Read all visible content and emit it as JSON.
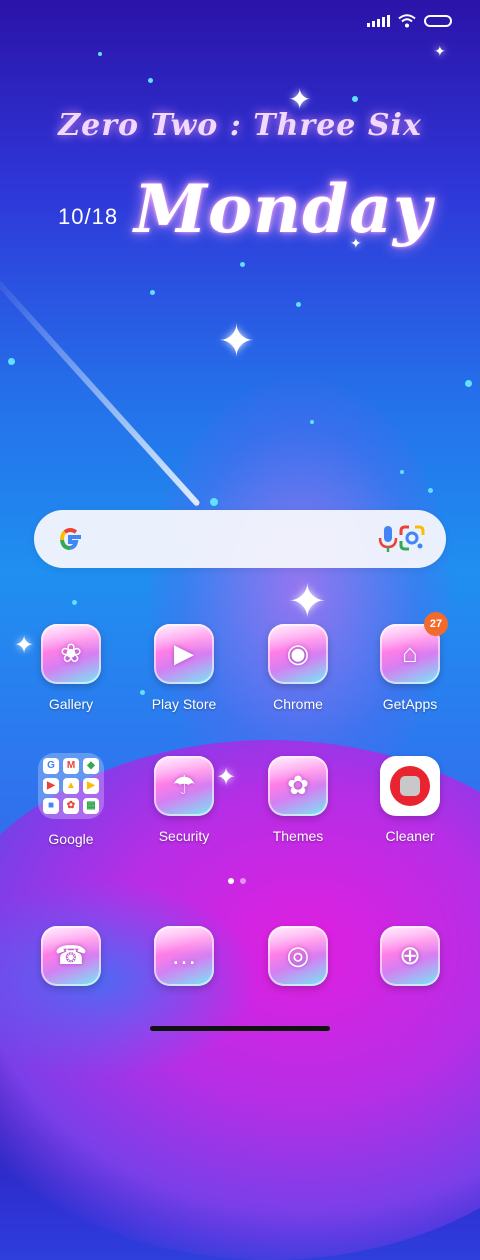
{
  "status_bar": {
    "signal_icon": "signal-icon",
    "wifi_icon": "wifi-icon",
    "battery_icon": "battery-icon"
  },
  "clock_widget": {
    "time_text": "Zero Two : Three Six",
    "date": "10/18",
    "day": "Monday"
  },
  "search_bar": {
    "google_icon": "google-g-icon",
    "mic_icon": "mic-icon",
    "lens_icon": "lens-icon"
  },
  "apps_row1": [
    {
      "label": "Gallery",
      "icon": "gallery-icon"
    },
    {
      "label": "Play Store",
      "icon": "play-store-icon"
    },
    {
      "label": "Chrome",
      "icon": "chrome-icon"
    },
    {
      "label": "GetApps",
      "icon": "getapps-icon",
      "badge": "27"
    }
  ],
  "apps_row2": [
    {
      "label": "Google",
      "icon": "google-folder-icon"
    },
    {
      "label": "Security",
      "icon": "security-icon"
    },
    {
      "label": "Themes",
      "icon": "themes-icon"
    },
    {
      "label": "Cleaner",
      "icon": "cleaner-icon"
    }
  ],
  "dock": [
    {
      "icon": "phone-icon"
    },
    {
      "icon": "messages-icon"
    },
    {
      "icon": "camera-icon"
    },
    {
      "icon": "browser-icon"
    }
  ],
  "colors": {
    "badge": "#f26a2c",
    "cleaner_red": "#e9232f"
  },
  "pager": {
    "pages": 2,
    "active": 1
  }
}
